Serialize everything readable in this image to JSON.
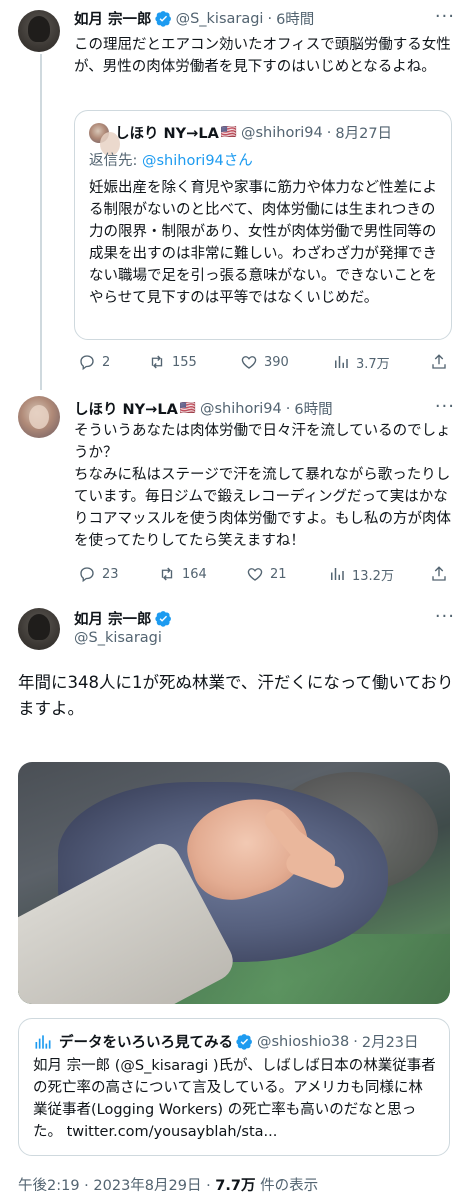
{
  "tweet1": {
    "display_name": "如月 宗一郎",
    "handle": "@S_kisaragi",
    "dot": "·",
    "time": "6時間",
    "more": "···",
    "text": "この理屈だとエアコン効いたオフィスで頭脳労働する女性が、男性の肉体労働者を見下すのはいじめとなるよね。",
    "quote": {
      "display_name": "しほり NY→LA",
      "flag": "🇺🇸",
      "handle": "@shihori94",
      "dot": "·",
      "time": "8月27日",
      "reply_to_prefix": "返信先: ",
      "reply_to_mention": "@shihori94",
      "reply_to_suffix": "さん",
      "text": "妊娠出産を除く育児や家事に筋力や体力など性差による制限がないのと比べて、肉体労働には生まれつきの力の限界・制限があり、女性が肉体労働で男性同等の成果を出すのは非常に難しい。わざわざ力が発揮できない職場で足を引っ張る意味がない。できないことをやらせて見下すのは平等ではなくいじめだ。"
    },
    "actions": {
      "replies": "2",
      "retweets": "155",
      "likes": "390",
      "views": "3.7万"
    }
  },
  "tweet2": {
    "display_name": "しほり NY→LA",
    "flag": "🇺🇸",
    "handle": "@shihori94",
    "dot": "·",
    "time": "6時間",
    "more": "···",
    "text1": "そういうあなたは肉体労働で日々汗を流しているのでしょうか？",
    "text2": "ちなみに私はステージで汗を流して暴れながら歌ったりしています。毎日ジムで鍛えレコーディングだって実はかなりコアマッスルを使う肉体労働ですよ。もし私の方が肉体を使ってたりしてたら笑えますね！",
    "actions": {
      "replies": "23",
      "retweets": "164",
      "likes": "21",
      "views": "13.2万"
    }
  },
  "tweet3": {
    "display_name": "如月 宗一郎",
    "handle": "@S_kisaragi",
    "more": "···",
    "text": "年間に348人に1が死ぬ林業で、汗だくになって働いておりますよ。",
    "card": {
      "display_name": "データをいろいろ見てみる",
      "handle": "@shioshio38",
      "dot": "·",
      "time": "2月23日",
      "text": "如月 宗一郎 (@S_kisaragi )氏が、しばしば日本の林業従事者の死亡率の高さについて言及している。アメリカも同様に林業従事者(Logging Workers) の死亡率も高いのだなと思った。 twitter.com/yousayblah/sta..."
    },
    "footer": {
      "time": "午後2:19",
      "dot": "·",
      "date": "2023年8月29日",
      "dot2": "·",
      "views": "7.7万",
      "views_label": " 件の表示"
    }
  },
  "colors": {
    "accent": "#1d9bf0",
    "text": "#0f1419",
    "muted": "#536471",
    "border": "#cfd9de"
  },
  "icons": [
    "verified-icon",
    "reply-icon",
    "retweet-icon",
    "like-icon",
    "views-icon",
    "share-icon",
    "more-icon",
    "bar-chart-icon"
  ]
}
